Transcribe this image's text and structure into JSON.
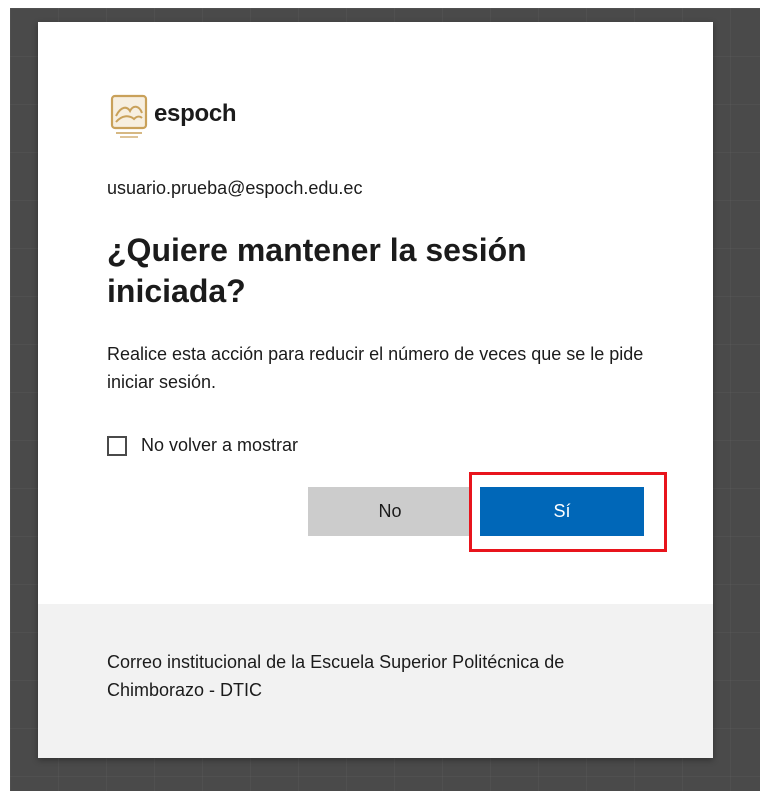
{
  "brand": {
    "name": "espoch",
    "logo_icon": "espoch-shield-logo",
    "logo_color": "#c9a15a"
  },
  "account": {
    "email": "usuario.prueba@espoch.edu.ec"
  },
  "prompt": {
    "title": "¿Quiere mantener la sesión iniciada?",
    "description": "Realice esta acción para reducir el número de veces que se le pide iniciar sesión."
  },
  "checkbox": {
    "label": "No volver a mostrar",
    "checked": false
  },
  "buttons": {
    "no_label": "No",
    "yes_label": "Sí"
  },
  "footer": {
    "text": "Correo institucional de la Escuela Superior Politécnica de Chimborazo - DTIC"
  },
  "colors": {
    "primary": "#0067b8",
    "secondary_button": "#cccccc",
    "highlight": "#e8141c",
    "footer_bg": "#f2f2f2",
    "backdrop": "#4a4a4a"
  }
}
